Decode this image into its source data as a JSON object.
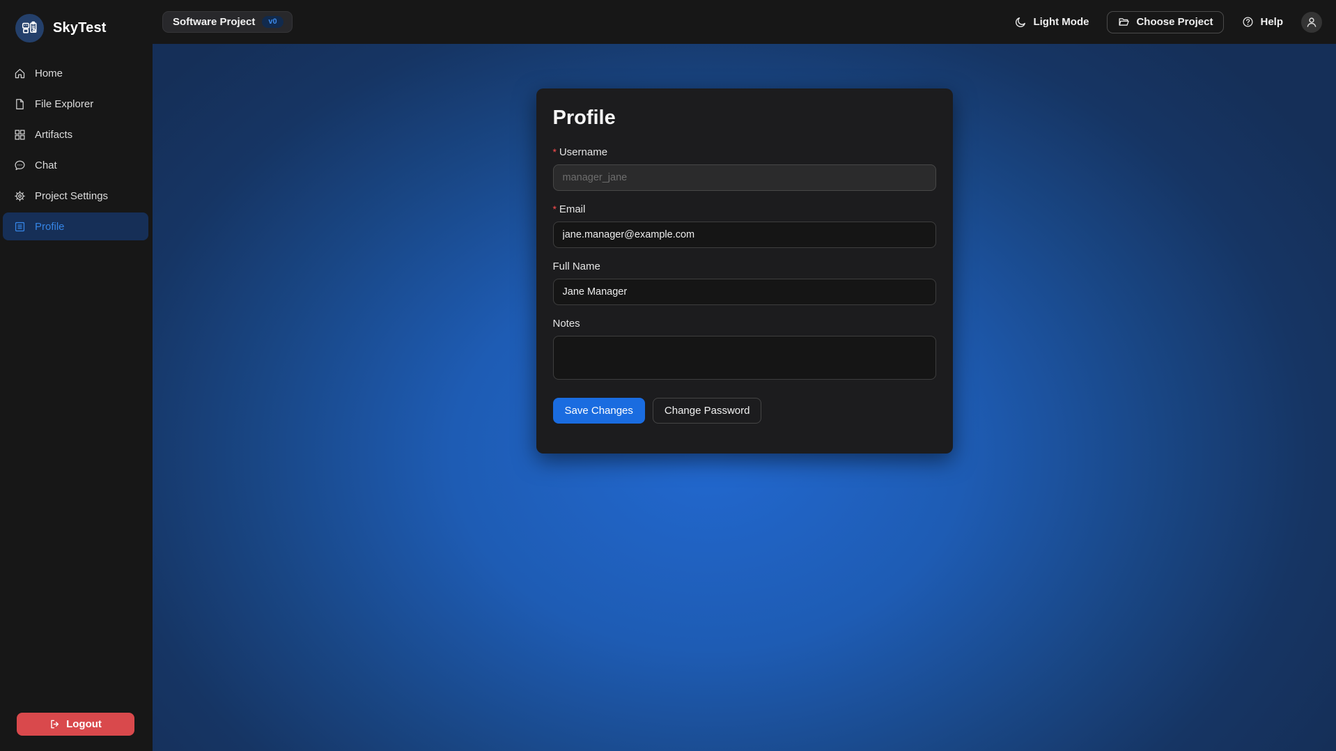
{
  "brand": {
    "name": "SkyTest"
  },
  "topbar": {
    "project_badge": {
      "label": "Software Project",
      "version": "v0"
    },
    "light_mode_label": "Light Mode",
    "choose_project_label": "Choose Project",
    "help_label": "Help"
  },
  "sidebar": {
    "items": [
      {
        "label": "Home",
        "icon": "home-icon",
        "active": false
      },
      {
        "label": "File Explorer",
        "icon": "file-icon",
        "active": false
      },
      {
        "label": "Artifacts",
        "icon": "appstore-grid-icon",
        "active": false
      },
      {
        "label": "Chat",
        "icon": "chat-bubble-icon",
        "active": false
      },
      {
        "label": "Project Settings",
        "icon": "gear-icon",
        "active": false
      },
      {
        "label": "Profile",
        "icon": "profile-card-icon",
        "active": true
      }
    ],
    "logout_label": "Logout"
  },
  "profile_form": {
    "title": "Profile",
    "fields": [
      {
        "label": "Username",
        "required": true,
        "value": "manager_jane",
        "disabled": true
      },
      {
        "label": "Email",
        "required": true,
        "value": "jane.manager@example.com",
        "disabled": false
      },
      {
        "label": "Full Name",
        "required": false,
        "value": "Jane Manager",
        "disabled": false
      },
      {
        "label": "Notes",
        "required": false,
        "value": "",
        "type": "textarea"
      }
    ],
    "save_label": "Save Changes",
    "change_password_label": "Change Password"
  },
  "colors": {
    "accent_blue": "#1a6ce0",
    "nav_selected_bg": "#162f57",
    "nav_selected_text": "#3585e6",
    "logout_red": "#d9494c",
    "required_asterisk": "#ff4d4f",
    "version_pill_bg": "#112a4d",
    "version_pill_text": "#3c89e8",
    "content_gradient_center": "#2268cf",
    "content_gradient_edge": "#152f58",
    "surface_dark": "#171717",
    "card_bg": "#1c1c1e"
  }
}
